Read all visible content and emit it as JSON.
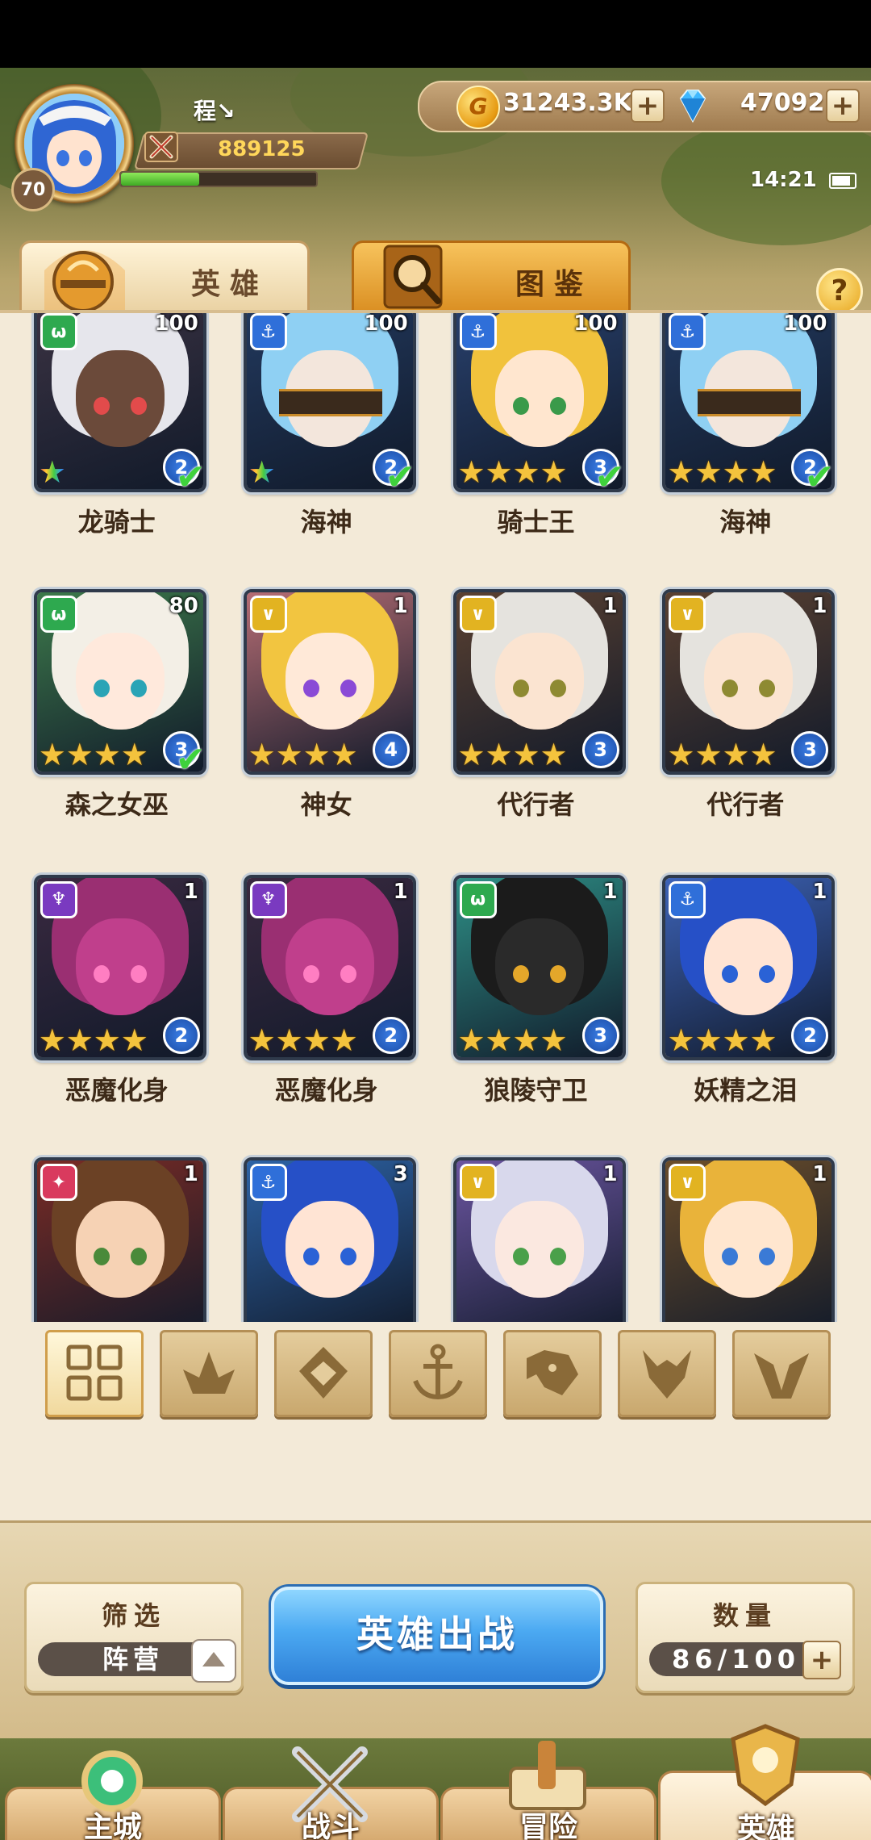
{
  "player": {
    "name": "程↘",
    "level": "70",
    "power": "889125",
    "exp_fraction": 0.4
  },
  "resources": {
    "gold": "31243.3K",
    "gems": "47092"
  },
  "clock": "14:21",
  "tabs": {
    "heroes": "英雄",
    "codex": "图鉴"
  },
  "help": "?",
  "heroes": [
    {
      "name": "龙骑士",
      "level": "100",
      "grade": "2",
      "faction": "beast",
      "stars": 1,
      "rainbow": true,
      "check": true
    },
    {
      "name": "海神",
      "level": "100",
      "grade": "2",
      "faction": "anchor",
      "stars": 1,
      "rainbow": true,
      "check": true
    },
    {
      "name": "骑士王",
      "level": "100",
      "grade": "3",
      "faction": "anchor",
      "stars": 4,
      "rainbow": false,
      "check": true
    },
    {
      "name": "海神",
      "level": "100",
      "grade": "2",
      "faction": "anchor",
      "stars": 4,
      "rainbow": false,
      "check": true
    },
    {
      "name": "森之女巫",
      "level": "80",
      "grade": "3",
      "faction": "beast",
      "stars": 4,
      "rainbow": false,
      "check": true
    },
    {
      "name": "神女",
      "level": "1",
      "grade": "4",
      "faction": "light",
      "stars": 4,
      "rainbow": false,
      "check": false
    },
    {
      "name": "代行者",
      "level": "1",
      "grade": "3",
      "faction": "light",
      "stars": 4,
      "rainbow": false,
      "check": false
    },
    {
      "name": "代行者",
      "level": "1",
      "grade": "3",
      "faction": "light",
      "stars": 4,
      "rainbow": false,
      "check": false
    },
    {
      "name": "恶魔化身",
      "level": "1",
      "grade": "2",
      "faction": "dark",
      "stars": 4,
      "rainbow": false,
      "check": false
    },
    {
      "name": "恶魔化身",
      "level": "1",
      "grade": "2",
      "faction": "dark",
      "stars": 4,
      "rainbow": false,
      "check": false
    },
    {
      "name": "狼陵守卫",
      "level": "1",
      "grade": "3",
      "faction": "beast",
      "stars": 4,
      "rainbow": false,
      "check": false
    },
    {
      "name": "妖精之泪",
      "level": "1",
      "grade": "2",
      "faction": "anchor",
      "stars": 4,
      "rainbow": false,
      "check": false
    },
    {
      "name": "",
      "level": "1",
      "grade": "",
      "faction": "fire",
      "stars": 0,
      "rainbow": false,
      "check": false
    },
    {
      "name": "",
      "level": "3",
      "grade": "",
      "faction": "anchor",
      "stars": 0,
      "rainbow": false,
      "check": false
    },
    {
      "name": "",
      "level": "1",
      "grade": "",
      "faction": "light",
      "stars": 0,
      "rainbow": false,
      "check": false
    },
    {
      "name": "",
      "level": "1",
      "grade": "",
      "faction": "light",
      "stars": 0,
      "rainbow": false,
      "check": false
    }
  ],
  "filters": [
    "all",
    "fire",
    "earth",
    "anchor",
    "beast",
    "dark",
    "light"
  ],
  "filter_active": "all",
  "filter_box": {
    "title": "筛选",
    "value": "阵营"
  },
  "deploy_button": "英雄出战",
  "count_box": {
    "title": "数量",
    "value": "86/100"
  },
  "nav": [
    "主城",
    "战斗",
    "冒险",
    "英雄"
  ],
  "nav_active": 3,
  "faction_colors": {
    "beast": "#2ea94f",
    "anchor": "#2f6fd9",
    "light": "#e2b321",
    "dark": "#7a3ac0",
    "fire": "#d93a5e"
  }
}
